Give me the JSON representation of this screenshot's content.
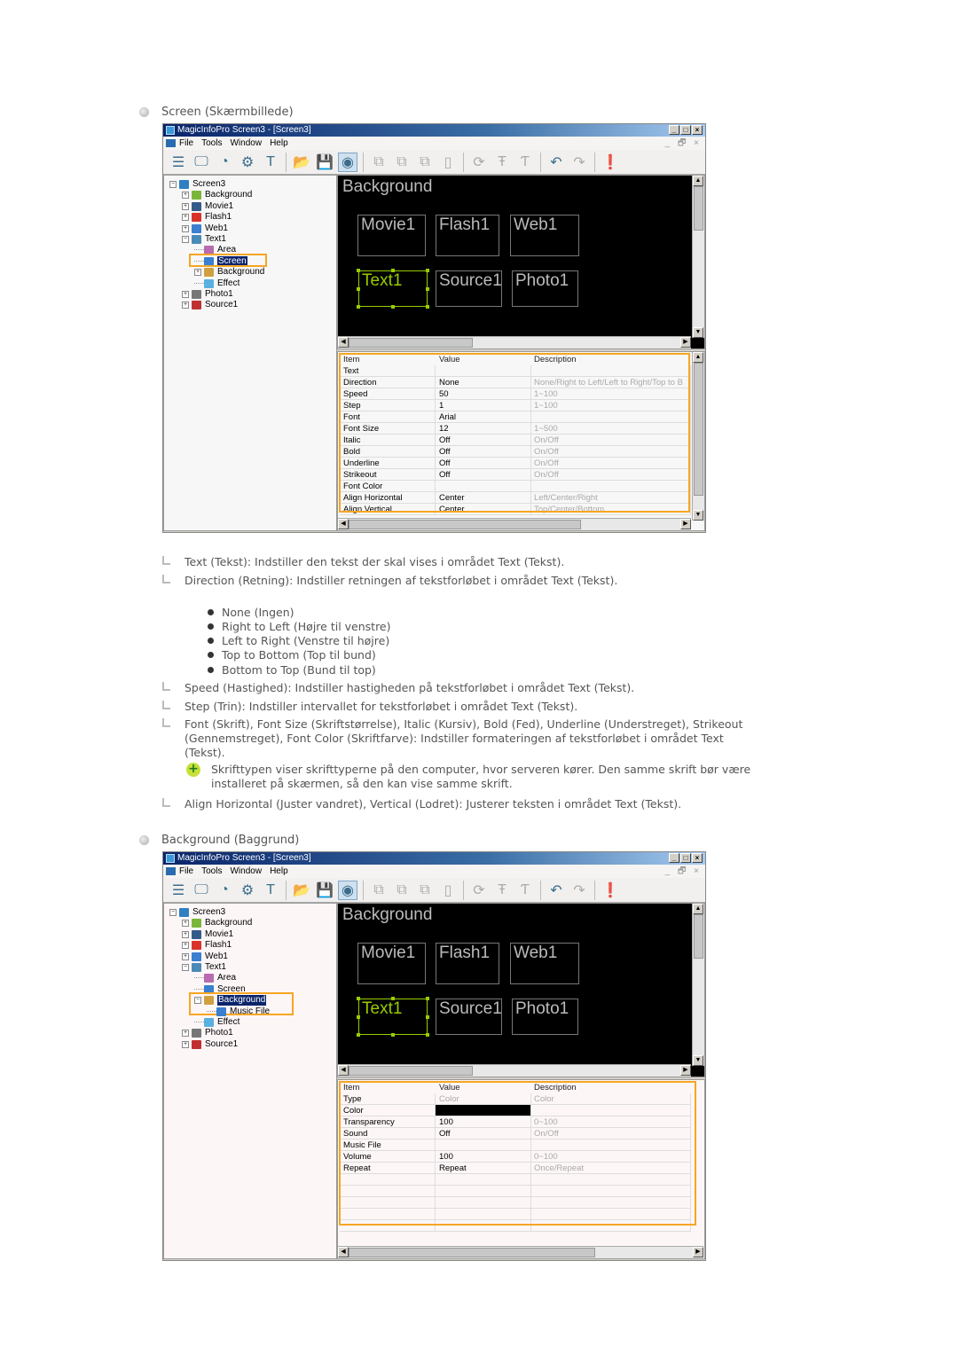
{
  "sections": [
    {
      "heading": "Screen (Skærmbillede)",
      "window": {
        "title": "MagicInfoPro Screen3 - [Screen3]",
        "menu": [
          "File",
          "Tools",
          "Window",
          "Help"
        ],
        "window_buttons": [
          "_",
          "□",
          "×"
        ],
        "mdi_buttons": "_ 🗗 ×",
        "toolbar": [
          {
            "icon": "network-icon",
            "state": "enabled"
          },
          {
            "icon": "monitor-icon",
            "state": "enabled"
          },
          {
            "icon": "clock-icon",
            "state": "enabled"
          },
          {
            "icon": "screen-settings-icon",
            "state": "enabled"
          },
          {
            "icon": "text-icon",
            "state": "enabled"
          },
          {
            "sep": true
          },
          {
            "icon": "open-folder-icon",
            "state": "enabled"
          },
          {
            "icon": "save-icon",
            "state": "enabled"
          },
          {
            "icon": "preview-eye-icon",
            "state": "selected"
          },
          {
            "sep": true
          },
          {
            "icon": "add-layer-icon",
            "state": "disabled"
          },
          {
            "icon": "copy-layer-icon",
            "state": "disabled"
          },
          {
            "icon": "paste-layer-icon",
            "state": "disabled"
          },
          {
            "icon": "delete-icon",
            "state": "disabled"
          },
          {
            "sep": true
          },
          {
            "icon": "refresh-icon",
            "state": "disabled"
          },
          {
            "icon": "text-in-icon",
            "state": "disabled"
          },
          {
            "icon": "text-out-icon",
            "state": "disabled"
          },
          {
            "sep": true
          },
          {
            "icon": "undo-icon",
            "state": "enabled"
          },
          {
            "icon": "redo-icon",
            "state": "disabled"
          },
          {
            "sep": true
          },
          {
            "icon": "info-icon",
            "state": "disabled"
          }
        ],
        "tree": [
          {
            "label": "Screen3",
            "level": 0,
            "expander": "-",
            "icon_color": "#2f7fc1",
            "icon": "screen-icon"
          },
          {
            "label": "Background",
            "level": 1,
            "expander": "+",
            "icon_color": "#7bb63a",
            "icon": "background-icon"
          },
          {
            "label": "Movie1",
            "level": 1,
            "expander": "+",
            "icon_color": "#345a8a",
            "icon": "movie-icon"
          },
          {
            "label": "Flash1",
            "level": 1,
            "expander": "+",
            "icon_color": "#d8322a",
            "icon": "flash-icon"
          },
          {
            "label": "Web1",
            "level": 1,
            "expander": "+",
            "icon_color": "#3a7fd0",
            "icon": "web-icon"
          },
          {
            "label": "Text1",
            "level": 1,
            "expander": "-",
            "icon_color": "#4a8ab8",
            "icon": "text-icon"
          },
          {
            "label": "Area",
            "level": 2,
            "expander": "",
            "icon_color": "#b96bb0",
            "icon": "area-icon"
          },
          {
            "label": "Screen",
            "level": 2,
            "expander": "",
            "icon_color": "#3a7fd0",
            "icon": "screen-icon",
            "selected": true
          },
          {
            "label": "Background",
            "level": 2,
            "expander": "+",
            "icon_color": "#d0a040",
            "icon": "background-icon"
          },
          {
            "label": "Effect",
            "level": 2,
            "expander": "",
            "icon_color": "#5ab0e0",
            "icon": "effect-icon"
          },
          {
            "label": "Photo1",
            "level": 1,
            "expander": "+",
            "icon_color": "#777",
            "icon": "photo-icon"
          },
          {
            "label": "Source1",
            "level": 1,
            "expander": "+",
            "icon_color": "#c03030",
            "icon": "source-icon"
          }
        ],
        "canvas": {
          "background_label": "Background",
          "boxes": [
            "Movie1",
            "Flash1",
            "Web1",
            "Text1",
            "Source1",
            "Photo1"
          ],
          "selected": "Text1"
        },
        "properties": {
          "headers": [
            "Item",
            "Value",
            "Description"
          ],
          "rows": [
            {
              "item": "Text",
              "value": "",
              "desc": ""
            },
            {
              "item": "Direction",
              "value": "None",
              "desc": "None/Right to Left/Left to Right/Top to B"
            },
            {
              "item": "Speed",
              "value": "50",
              "desc": "1~100"
            },
            {
              "item": "Step",
              "value": "1",
              "desc": "1~100"
            },
            {
              "item": "Font",
              "value": "Arial",
              "desc": ""
            },
            {
              "item": "Font Size",
              "value": "12",
              "desc": "1~500"
            },
            {
              "item": "Italic",
              "value": "Off",
              "desc": "On/Off"
            },
            {
              "item": "Bold",
              "value": "Off",
              "desc": "On/Off"
            },
            {
              "item": "Underline",
              "value": "Off",
              "desc": "On/Off"
            },
            {
              "item": "Strikeout",
              "value": "Off",
              "desc": "On/Off"
            },
            {
              "item": "Font Color",
              "value": "",
              "desc": ""
            },
            {
              "item": "Align Horizontal",
              "value": "Center",
              "desc": "Left/Center/Right"
            },
            {
              "item": "Align Vertical",
              "value": "Center",
              "desc": "Top/Center/Bottom"
            }
          ]
        }
      }
    },
    {
      "heading": "Background (Baggrund)",
      "window": {
        "title": "MagicInfoPro Screen3 - [Screen3]",
        "menu": [
          "File",
          "Tools",
          "Window",
          "Help"
        ],
        "tree": [
          {
            "label": "Screen3",
            "level": 0,
            "expander": "-",
            "icon_color": "#2f7fc1",
            "icon": "screen-icon"
          },
          {
            "label": "Background",
            "level": 1,
            "expander": "+",
            "icon_color": "#7bb63a",
            "icon": "background-icon"
          },
          {
            "label": "Movie1",
            "level": 1,
            "expander": "+",
            "icon_color": "#345a8a",
            "icon": "movie-icon"
          },
          {
            "label": "Flash1",
            "level": 1,
            "expander": "+",
            "icon_color": "#d8322a",
            "icon": "flash-icon"
          },
          {
            "label": "Web1",
            "level": 1,
            "expander": "+",
            "icon_color": "#3a7fd0",
            "icon": "web-icon"
          },
          {
            "label": "Text1",
            "level": 1,
            "expander": "-",
            "icon_color": "#4a8ab8",
            "icon": "text-icon"
          },
          {
            "label": "Area",
            "level": 2,
            "expander": "",
            "icon_color": "#b96bb0",
            "icon": "area-icon"
          },
          {
            "label": "Screen",
            "level": 2,
            "expander": "",
            "icon_color": "#3a7fd0",
            "icon": "screen-icon"
          },
          {
            "label": "Background",
            "level": 2,
            "expander": "-",
            "icon_color": "#d0a040",
            "icon": "background-icon",
            "selected": true
          },
          {
            "label": "Music File",
            "level": 3,
            "expander": "",
            "icon_color": "#3a7fd0",
            "icon": "music-icon"
          },
          {
            "label": "Effect",
            "level": 2,
            "expander": "",
            "icon_color": "#5ab0e0",
            "icon": "effect-icon"
          },
          {
            "label": "Photo1",
            "level": 1,
            "expander": "+",
            "icon_color": "#777",
            "icon": "photo-icon"
          },
          {
            "label": "Source1",
            "level": 1,
            "expander": "+",
            "icon_color": "#c03030",
            "icon": "source-icon"
          }
        ],
        "canvas": {
          "background_label": "Background",
          "boxes": [
            "Movie1",
            "Flash1",
            "Web1",
            "Text1",
            "Source1",
            "Photo1"
          ],
          "selected": "Text1"
        },
        "properties": {
          "headers": [
            "Item",
            "Value",
            "Description"
          ],
          "rows": [
            {
              "item": "Type",
              "value": "Color",
              "desc": "Color",
              "value_muted": true
            },
            {
              "item": "Color",
              "value": "",
              "desc": "",
              "swatch": "#000000"
            },
            {
              "item": "Transparency",
              "value": "100",
              "desc": "0~100"
            },
            {
              "item": "Sound",
              "value": "Off",
              "desc": "On/Off"
            },
            {
              "item": "Music File",
              "value": "",
              "desc": ""
            },
            {
              "item": "Volume",
              "value": "100",
              "desc": "0~100"
            },
            {
              "item": "Repeat",
              "value": "Repeat",
              "desc": "Once/Repeat"
            },
            {
              "item": "",
              "value": "",
              "desc": ""
            },
            {
              "item": "",
              "value": "",
              "desc": ""
            },
            {
              "item": "",
              "value": "",
              "desc": ""
            },
            {
              "item": "",
              "value": "",
              "desc": ""
            },
            {
              "item": "",
              "value": "",
              "desc": ""
            }
          ]
        }
      }
    }
  ],
  "notes": {
    "text": "Text (Tekst): Indstiller den tekst der skal vises i området Text (Tekst).",
    "direction": "Direction (Retning): Indstiller retningen af tekstforløbet i området Text (Tekst).",
    "direction_options": [
      "None (Ingen)",
      "Right to Left (Højre til venstre)",
      "Left to Right (Venstre til højre)",
      "Top to Bottom (Top til bund)",
      "Bottom to Top (Bund til top)"
    ],
    "speed": "Speed (Hastighed): Indstiller hastigheden på tekstforløbet i området Text (Tekst).",
    "step": "Step (Trin): Indstiller intervallet for tekstforløbet i området Text (Tekst).",
    "font": "Font (Skrift), Font Size (Skriftstørrelse), Italic (Kursiv), Bold (Fed), Underline (Understreget), Strikeout (Gennemstreget), Font Color (Skriftfarve): Indstiller formateringen af tekstforløbet i området Text (Tekst).",
    "tip": "Skrifttypen viser skrifttyperne på den computer, hvor serveren kører. Den samme skrift bør være installeret på skærmen, så den kan vise samme skrift.",
    "align": "Align Horizontal (Juster vandret), Vertical (Lodret): Justerer teksten i området Text (Tekst)."
  },
  "colors": {
    "highlight": "#f6a623",
    "selection": "#0a246a",
    "canvas_selected": "#99cc00"
  }
}
